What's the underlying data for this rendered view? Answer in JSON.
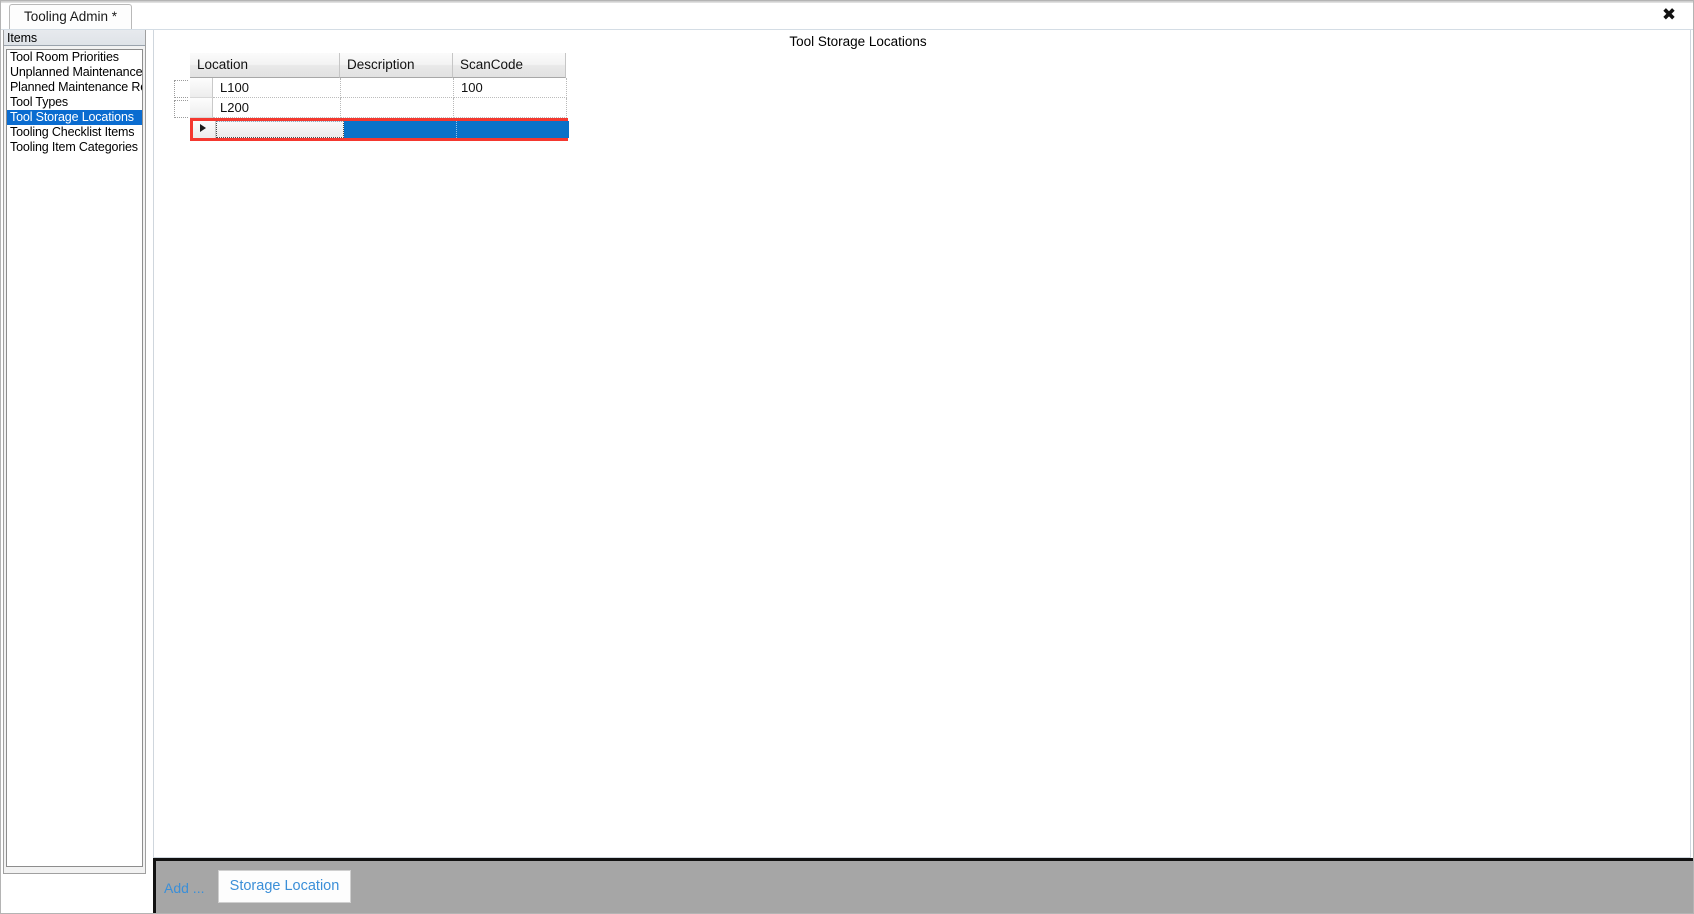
{
  "window": {
    "close_label": "✖"
  },
  "tabs": [
    {
      "label": "Tooling Admin *"
    }
  ],
  "sidebar": {
    "header": "Items",
    "items": [
      {
        "label": "Tool Room Priorities"
      },
      {
        "label": "Unplanned Maintenance"
      },
      {
        "label": "Planned Maintenance Re"
      },
      {
        "label": "Tool Types"
      },
      {
        "label": "Tool Storage Locations"
      },
      {
        "label": "Tooling Checklist Items"
      },
      {
        "label": "Tooling Item Categories"
      }
    ],
    "selected_index": 4
  },
  "main": {
    "title": "Tool Storage Locations"
  },
  "grid": {
    "columns": [
      "Location",
      "Description",
      "ScanCode"
    ],
    "rows": [
      {
        "location": "L100",
        "description": "",
        "scancode": "100"
      },
      {
        "location": "L200",
        "description": "",
        "scancode": ""
      }
    ],
    "new_row": {
      "location": "",
      "description": "",
      "scancode": "",
      "is_editing": true
    }
  },
  "bottom_bar": {
    "add_label": "Add ...",
    "storage_location_label": "Storage Location"
  },
  "colors": {
    "selection_blue": "#0a72c8",
    "sidebar_selection": "#0a6cd0",
    "edit_row_highlight": "#f4382f",
    "link_blue": "#3b8fd8",
    "bottom_bar_gray": "#a6a6a6"
  }
}
